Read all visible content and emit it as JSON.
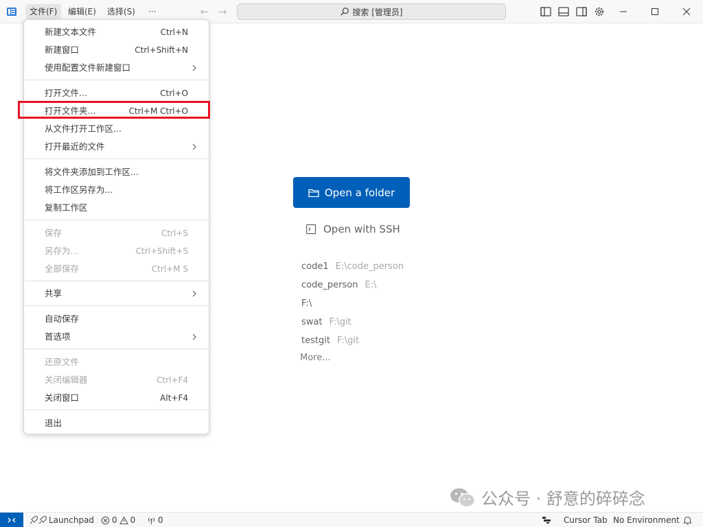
{
  "titlebar": {
    "menus": [
      "文件(F)",
      "编辑(E)",
      "选择(S)",
      "···"
    ],
    "search_text": "搜索 [管理员]"
  },
  "file_menu": {
    "items": [
      {
        "label": "新建文本文件",
        "shortcut": "Ctrl+N"
      },
      {
        "label": "新建窗口",
        "shortcut": "Ctrl+Shift+N"
      },
      {
        "label": "使用配置文件新建窗口",
        "shortcut": ""
      },
      {
        "label": "打开文件...",
        "shortcut": "Ctrl+O"
      },
      {
        "label": "打开文件夹...",
        "shortcut": "Ctrl+M Ctrl+O"
      },
      {
        "label": "从文件打开工作区...",
        "shortcut": ""
      },
      {
        "label": "打开最近的文件",
        "shortcut": ""
      },
      {
        "label": "将文件夹添加到工作区...",
        "shortcut": ""
      },
      {
        "label": "将工作区另存为...",
        "shortcut": ""
      },
      {
        "label": "复制工作区",
        "shortcut": ""
      },
      {
        "label": "保存",
        "shortcut": "Ctrl+S"
      },
      {
        "label": "另存为...",
        "shortcut": "Ctrl+Shift+S"
      },
      {
        "label": "全部保存",
        "shortcut": "Ctrl+M S"
      },
      {
        "label": "共享",
        "shortcut": ""
      },
      {
        "label": "自动保存",
        "shortcut": ""
      },
      {
        "label": "首选项",
        "shortcut": ""
      },
      {
        "label": "还原文件",
        "shortcut": ""
      },
      {
        "label": "关闭编辑器",
        "shortcut": "Ctrl+F4"
      },
      {
        "label": "关闭窗口",
        "shortcut": "Alt+F4"
      },
      {
        "label": "退出",
        "shortcut": ""
      }
    ]
  },
  "welcome": {
    "open_folder_label": "Open a folder",
    "open_ssh_label": "Open with SSH",
    "recent": [
      {
        "name": "code1",
        "path": "E:\\code_person"
      },
      {
        "name": "code_person",
        "path": "E:\\"
      },
      {
        "name": "F:\\",
        "path": ""
      },
      {
        "name": "swat",
        "path": "F:\\git"
      },
      {
        "name": "testgit",
        "path": "F:\\git"
      }
    ],
    "more_label": "More..."
  },
  "statusbar": {
    "launchpad": "Launchpad",
    "errors": "0",
    "warnings": "0",
    "ports": "0",
    "cursor_tab": "Cursor Tab",
    "environment": "No Environment"
  },
  "watermark": {
    "text": "公众号 · 舒意的碎碎念"
  },
  "colors": {
    "accent": "#005fb8",
    "highlight": "#e81123"
  }
}
